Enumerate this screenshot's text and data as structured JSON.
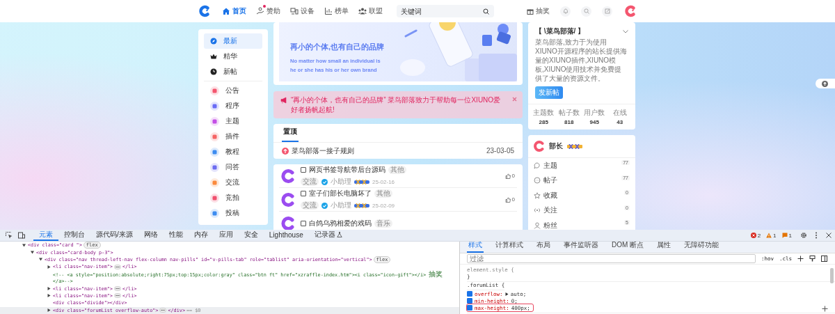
{
  "nav": {
    "items": [
      {
        "label": "首页",
        "selected": true,
        "dot": false
      },
      {
        "label": "赞助",
        "selected": false,
        "dot": true
      },
      {
        "label": "设备",
        "selected": false,
        "dot": false
      },
      {
        "label": "榜单",
        "selected": false,
        "dot": false
      },
      {
        "label": "联盟",
        "selected": false,
        "dot": false
      }
    ],
    "search": {
      "placeholder": "关键词"
    },
    "lottery": "抽奖"
  },
  "sidebar": {
    "items": [
      {
        "kind": "main",
        "label": "最新",
        "selected": true
      },
      {
        "kind": "main",
        "label": "精华",
        "selected": false
      },
      {
        "kind": "main",
        "label": "新帖",
        "selected": false
      },
      {
        "kind": "forum",
        "label": "公告",
        "selected": false,
        "color": "#f4566f"
      },
      {
        "kind": "forum",
        "label": "程序",
        "selected": false,
        "color": "#6a6cf6"
      },
      {
        "kind": "forum",
        "label": "主题",
        "selected": false,
        "color": "#c44fe6"
      },
      {
        "kind": "forum",
        "label": "插件",
        "selected": false,
        "color": "#f56464"
      },
      {
        "kind": "forum",
        "label": "教程",
        "selected": false,
        "color": "#3c8cf0"
      },
      {
        "kind": "forum",
        "label": "问答",
        "selected": false,
        "color": "#6c6cf0"
      },
      {
        "kind": "forum",
        "label": "交流",
        "selected": false,
        "color": "#fb8a3c"
      },
      {
        "kind": "forum",
        "label": "竞拍",
        "selected": false,
        "color": "#f0506e"
      },
      {
        "kind": "forum",
        "label": "投稿",
        "selected": false,
        "color": "#3c8cf0"
      }
    ]
  },
  "banner": {
    "title": "再小的个体,也有自己的品牌",
    "subtitle_lines": [
      "No matter how small an individual is",
      "he or she has his or her own brand"
    ]
  },
  "alert": {
    "text": "“再小的个体，也有自己的品牌” 菜鸟部落致力于帮助每一位XIUNO爱好者扬帆起航!"
  },
  "pinned": {
    "tabs": [
      {
        "label": "置顶",
        "selected": true
      }
    ],
    "rows": [
      {
        "title": "菜鸟部落一接子规则",
        "date": "23-03-05"
      }
    ]
  },
  "threads": [
    {
      "title": "网页书签导航带后台源码",
      "tag": "其他",
      "checked": false,
      "forum": "交流",
      "author": "小助理",
      "date": "25-02-16",
      "likes": "0"
    },
    {
      "title": "室子们部长电脑坏了",
      "tag": "其他",
      "checked": false,
      "forum": "交流",
      "author": "小助理",
      "date": "25-02-09",
      "likes": "0"
    },
    {
      "title": "白鸽乌鸦相爱的戏码",
      "tag": "音乐",
      "checked": false
    }
  ],
  "site": {
    "title": "【 \\菜鸟部落/ 】",
    "description": "菜鸟部落,致力于为使用XIUNO开源程序的站长提供海量的XIUNO插件,XIUNO模板,XIUNO使用技术并免费提供了大量的资源文件。",
    "button": "发新帖",
    "stats": [
      {
        "label": "主题数",
        "value": "285"
      },
      {
        "label": "帖子数",
        "value": "818"
      },
      {
        "label": "用户数",
        "value": "945"
      },
      {
        "label": "在线",
        "value": "43"
      }
    ]
  },
  "user": {
    "name": "部长",
    "items": [
      {
        "label": "主题",
        "count": "77"
      },
      {
        "label": "帖子",
        "count": "77"
      },
      {
        "label": "收藏",
        "count": "0"
      },
      {
        "label": "关注",
        "count": "0"
      },
      {
        "label": "粉丝",
        "count": "5"
      }
    ]
  },
  "devtools": {
    "tabs": [
      {
        "label": "元素",
        "selected": true,
        "badge_icon": false
      },
      {
        "label": "控制台",
        "selected": false,
        "badge_icon": false
      },
      {
        "label": "源代码/来源",
        "selected": false,
        "badge_icon": false
      },
      {
        "label": "网络",
        "selected": false,
        "badge_icon": false
      },
      {
        "label": "性能",
        "selected": false,
        "badge_icon": false
      },
      {
        "label": "内存",
        "selected": false,
        "badge_icon": false
      },
      {
        "label": "应用",
        "selected": false,
        "badge_icon": false
      },
      {
        "label": "安全",
        "selected": false,
        "badge_icon": false
      },
      {
        "label": "Lighthouse",
        "selected": false,
        "badge_icon": false
      },
      {
        "label": "记录器",
        "selected": false,
        "badge_icon": true
      }
    ],
    "counts": {
      "errors": "2",
      "warnings": "1",
      "issues": "1"
    },
    "dom": [
      {
        "kind": "element",
        "text": "<div class=\"card \">",
        "badge": "flex",
        "expanded": true,
        "selected": false,
        "children": [
          {
            "kind": "element",
            "text": "<div class=\"card-body p-3\">",
            "expanded": true,
            "selected": false,
            "children": [
              {
                "kind": "element",
                "text": "<div class=\"nav thread-left-nav flex-column nav-pills\" id=\"v-pills-tab\" role=\"tablist\" aria-orientation=\"vertical\">",
                "badge": "flex",
                "expanded": true,
                "selected": false,
                "children": [
                  {
                    "kind": "element",
                    "text": "<li class=\"nav-item\">",
                    "close": "</li>",
                    "expanded": false,
                    "selected": false
                  },
                  {
                    "kind": "comment",
                    "lines": [
                      "<!-- <a style=\"position:absolute;right:75px;top:15px;color:gray\" class=\"btn ft\" href=\"xzraffle-index.htm\"><i class=\"icon-gift\"></i> 抽奖",
                      "</a>-->"
                    ],
                    "selected": false
                  },
                  {
                    "kind": "element",
                    "text": "<li class=\"nav-item\">",
                    "close": "</li>",
                    "expanded": false,
                    "selected": false
                  },
                  {
                    "kind": "element",
                    "text": "<li class=\"nav-item\">",
                    "close": "</li>",
                    "expanded": false,
                    "selected": false
                  },
                  {
                    "kind": "leaf",
                    "text": "<div class=\"divide\"></div>",
                    "selected": false
                  },
                  {
                    "kind": "element",
                    "text": "<div class=\"forumList overflow-auto\">",
                    "close": "</div>",
                    "suffix": "== $0",
                    "expanded": false,
                    "selected": true
                  }
                ]
              }
            ]
          }
        ]
      }
    ],
    "styles": {
      "tabs": [
        {
          "label": "样式",
          "selected": true
        },
        {
          "label": "计算样式",
          "selected": false
        },
        {
          "label": "布局",
          "selected": false
        },
        {
          "label": "事件监听器",
          "selected": false
        },
        {
          "label": "DOM 断点",
          "selected": false
        },
        {
          "label": "属性",
          "selected": false
        },
        {
          "label": "无障碍功能",
          "selected": false
        }
      ],
      "filter": {
        "placeholder": "过滤"
      },
      "toggles": [
        ":hov",
        ".cls"
      ],
      "rules": [
        {
          "kind": "inline",
          "selector": "element.style {",
          "close": "}"
        },
        {
          "kind": "rule",
          "selector": ".forumList {",
          "properties": [
            {
              "name": "overflow:",
              "value": "auto;",
              "expandable": true,
              "checked": true,
              "highlighted": false
            },
            {
              "name": "min-height:",
              "value": "0;",
              "expandable": false,
              "checked": true,
              "highlighted": false
            },
            {
              "name": "max-height:",
              "value": "400px;",
              "expandable": false,
              "checked": true,
              "highlighted": true
            }
          ]
        }
      ]
    }
  }
}
